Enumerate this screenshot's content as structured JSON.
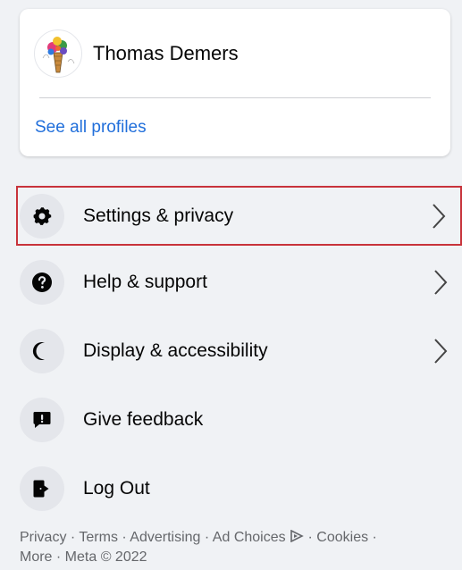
{
  "profile": {
    "name": "Thomas Demers",
    "see_all_label": "See all profiles"
  },
  "menu": {
    "items": [
      {
        "label": "Settings & privacy",
        "icon": "gear-icon",
        "has_chevron": true,
        "highlighted": true
      },
      {
        "label": "Help & support",
        "icon": "question-icon",
        "has_chevron": true
      },
      {
        "label": "Display & accessibility",
        "icon": "moon-icon",
        "has_chevron": true
      },
      {
        "label": "Give feedback",
        "icon": "feedback-icon",
        "has_chevron": false
      },
      {
        "label": "Log Out",
        "icon": "logout-icon",
        "has_chevron": false
      }
    ]
  },
  "footer": {
    "privacy": "Privacy",
    "terms": "Terms",
    "advertising": "Advertising",
    "ad_choices": "Ad Choices",
    "cookies": "Cookies",
    "more": "More",
    "copyright": "Meta © 2022",
    "separator": " · "
  },
  "colors": {
    "background": "#f0f2f5",
    "link": "#216fdb",
    "highlight_border": "#c8333b",
    "icon_bg": "#e4e6eb"
  }
}
